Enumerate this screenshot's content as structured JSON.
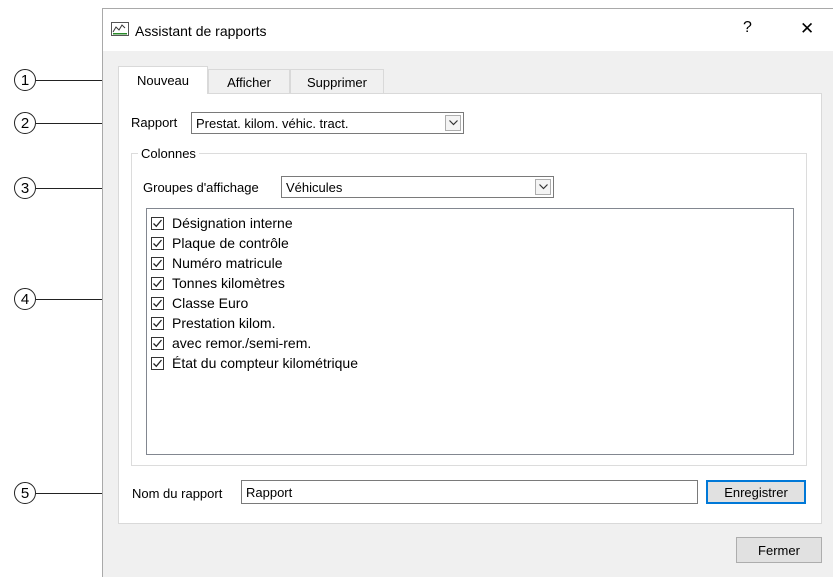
{
  "window": {
    "title": "Assistant de rapports",
    "help_label": "?",
    "close_label": "✕"
  },
  "tabs": [
    {
      "label": "Nouveau",
      "active": true
    },
    {
      "label": "Afficher",
      "active": false
    },
    {
      "label": "Supprimer",
      "active": false
    }
  ],
  "report": {
    "label": "Rapport",
    "selected": "Prestat. kilom. véhic. tract."
  },
  "columns": {
    "group_title": "Colonnes",
    "display_groups_label": "Groupes d'affichage",
    "display_groups_selected": "Véhicules",
    "items": [
      {
        "label": "Désignation interne",
        "checked": true
      },
      {
        "label": "Plaque de contrôle",
        "checked": true
      },
      {
        "label": "Numéro matricule",
        "checked": true
      },
      {
        "label": "Tonnes kilomètres",
        "checked": true
      },
      {
        "label": "Classe Euro",
        "checked": true
      },
      {
        "label": "Prestation kilom.",
        "checked": true
      },
      {
        "label": "avec remor./semi-rem.",
        "checked": true
      },
      {
        "label": "État du compteur kilométrique",
        "checked": true
      }
    ]
  },
  "report_name": {
    "label": "Nom du rapport",
    "value": "Rapport",
    "save_label": "Enregistrer"
  },
  "footer": {
    "close_label": "Fermer"
  },
  "callouts": [
    "1",
    "2",
    "3",
    "4",
    "5"
  ],
  "colors": {
    "window_bg": "#f0f0f0",
    "panel_bg": "#ffffff",
    "accent": "#0078d7"
  }
}
